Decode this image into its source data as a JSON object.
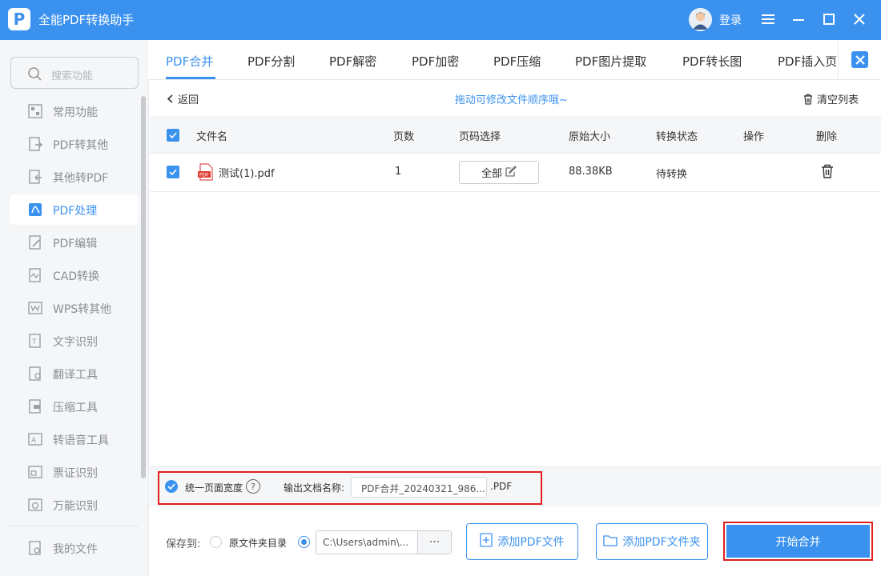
{
  "app": {
    "title": "全能PDF转换助手",
    "logo_text": "P",
    "login_label": "登录"
  },
  "colors": {
    "brand": "#3b92ee",
    "highlight_border": "#e02020",
    "sidebar_bg": "#f5f6f8"
  },
  "sidebar": {
    "search_placeholder": "搜索功能",
    "items": [
      {
        "label": "常用功能",
        "icon": "star-grid-icon"
      },
      {
        "label": "PDF转其他",
        "icon": "pdf-export-icon"
      },
      {
        "label": "其他转PDF",
        "icon": "pdf-import-icon"
      },
      {
        "label": "PDF处理",
        "icon": "pdf-process-icon",
        "active": true
      },
      {
        "label": "PDF编辑",
        "icon": "pdf-edit-icon"
      },
      {
        "label": "CAD转换",
        "icon": "cad-icon"
      },
      {
        "label": "WPS转其他",
        "icon": "wps-icon"
      },
      {
        "label": "文字识别",
        "icon": "ocr-icon"
      },
      {
        "label": "翻译工具",
        "icon": "translate-icon"
      },
      {
        "label": "压缩工具",
        "icon": "zip-icon"
      },
      {
        "label": "转语音工具",
        "icon": "voice-icon"
      },
      {
        "label": "票证识别",
        "icon": "ticket-icon"
      },
      {
        "label": "万能识别",
        "icon": "universal-recognize-icon"
      }
    ],
    "my_files": "我的文件"
  },
  "tabs": [
    "PDF合并",
    "PDF分割",
    "PDF解密",
    "PDF加密",
    "PDF压缩",
    "PDF图片提取",
    "PDF转长图",
    "PDF插入页"
  ],
  "toolbar": {
    "back": "返回",
    "hint": "拖动可修改文件顺序哦~",
    "clear": "清空列表"
  },
  "table": {
    "headers": [
      "文件名",
      "页数",
      "页码选择",
      "原始大小",
      "转换状态",
      "操作",
      "删除"
    ],
    "rows": [
      {
        "name": "测试(1).pdf",
        "pages": "1",
        "range": "全部",
        "size": "88.38KB",
        "status": "待转换",
        "file_badge": "PDF"
      }
    ]
  },
  "options": {
    "unify_width": "统一页面宽度",
    "help": "?",
    "output_name_label": "输出文档名称:",
    "output_name_value": "PDF合并_20240321_986...",
    "ext": ".PDF"
  },
  "bottom": {
    "save_to": "保存到:",
    "orig_dir": "原文件夹目录",
    "path": "C:\\Users\\admin\\...",
    "more": "···",
    "add_file": "添加PDF文件",
    "add_folder": "添加PDF文件夹",
    "start": "开始合并"
  }
}
